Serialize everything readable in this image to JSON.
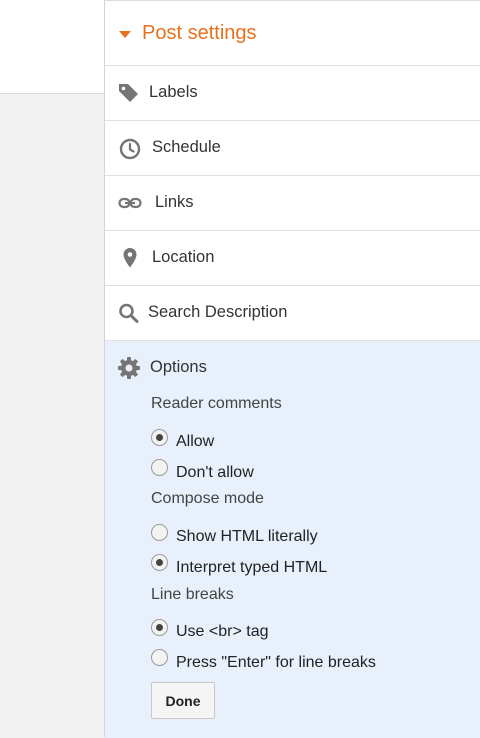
{
  "post_settings": {
    "title": "Post settings",
    "items": [
      {
        "label": "Labels",
        "icon": "tag-icon"
      },
      {
        "label": "Schedule",
        "icon": "clock-icon"
      },
      {
        "label": "Links",
        "icon": "link-icon"
      },
      {
        "label": "Location",
        "icon": "location-pin-icon"
      },
      {
        "label": "Search Description",
        "icon": "search-icon"
      }
    ]
  },
  "options": {
    "title": "Options",
    "icon": "gear-icon",
    "reader_comments": {
      "heading": "Reader comments",
      "choices": [
        {
          "label": "Allow",
          "selected": true
        },
        {
          "label": "Don't allow",
          "selected": false
        }
      ]
    },
    "compose_mode": {
      "heading": "Compose mode",
      "choices": [
        {
          "label": "Show HTML literally",
          "selected": false
        },
        {
          "label": "Interpret typed HTML",
          "selected": true
        }
      ]
    },
    "line_breaks": {
      "heading": "Line breaks",
      "choices": [
        {
          "label": "Use <br> tag",
          "selected": true
        },
        {
          "label": "Press \"Enter\" for line breaks",
          "selected": false
        }
      ]
    },
    "done_label": "Done"
  },
  "colors": {
    "accent": "#e8711c",
    "options_bg": "#e8f0fb",
    "icon": "#757575"
  }
}
